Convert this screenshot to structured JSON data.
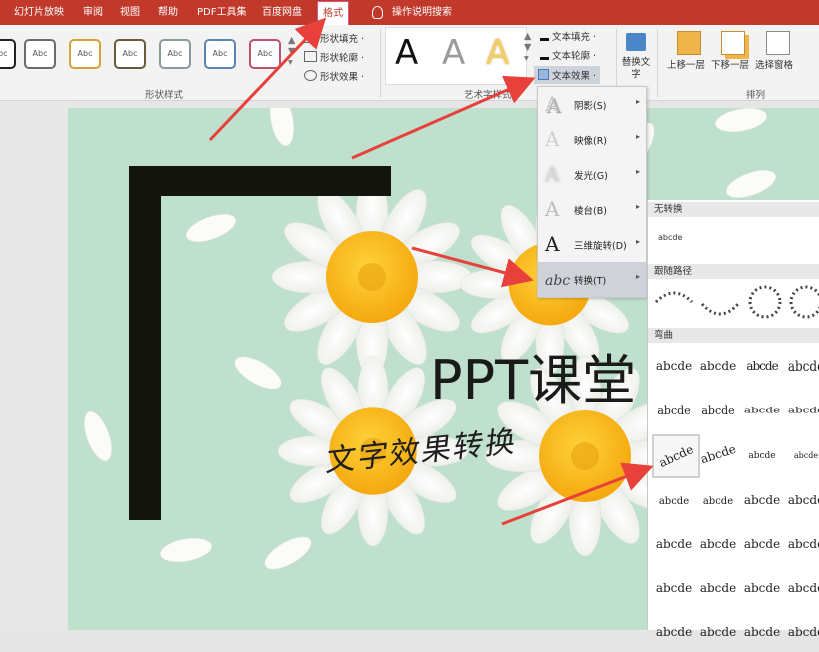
{
  "tabs": [
    {
      "label": "幻灯片放映"
    },
    {
      "label": "审阅"
    },
    {
      "label": "视图"
    },
    {
      "label": "帮助"
    },
    {
      "label": "PDF工具集"
    },
    {
      "label": "百度网盘"
    },
    {
      "label": "格式",
      "active": true
    },
    {
      "label": "操作说明搜索"
    }
  ],
  "ribbon": {
    "shape_styles": {
      "swatch_text": "Abc",
      "swatch_colors": [
        "#222222",
        "#6b6b6b",
        "#d6a23a",
        "#6b5a3a",
        "#8a9aa0",
        "#5a86b4",
        "#c2506c"
      ],
      "fill": "形状填充 ·",
      "outline": "形状轮廓 ·",
      "effects": "形状效果 ·",
      "group_label": "形状样式"
    },
    "wordart": {
      "glyph": "A",
      "text_fill": "文本填充 ·",
      "text_outline": "文本轮廓 ·",
      "text_effects": "文本效果 ·",
      "group_label": "艺术字样式"
    },
    "alt_text": "替换文字",
    "arrange": {
      "bring_forward": "上移一层",
      "send_backward": "下移一层",
      "selection_pane": "选择窗格",
      "group_label": "排列"
    }
  },
  "effects_menu": [
    {
      "icon": "A",
      "label": "阴影(S)"
    },
    {
      "icon": "A",
      "label": "映像(R)"
    },
    {
      "icon": "A",
      "label": "发光(G)"
    },
    {
      "icon": "A",
      "label": "棱台(B)"
    },
    {
      "icon": "A",
      "label": "三维旋转(D)"
    },
    {
      "icon": "abc",
      "label": "转换(T)",
      "selected": true
    }
  ],
  "transform_panel": {
    "no_transform": "无转换",
    "no_transform_sample": "abcde",
    "follow_path": "跟随路径",
    "warp": "弯曲",
    "sample": "abcde"
  },
  "slide": {
    "title": "PPT课堂",
    "subtitle": "文字效果转换"
  },
  "colors": {
    "tab_bg": "#c0392b",
    "slide_bg": "#bfe0cd",
    "annotation_arrow": "#e8403a"
  }
}
